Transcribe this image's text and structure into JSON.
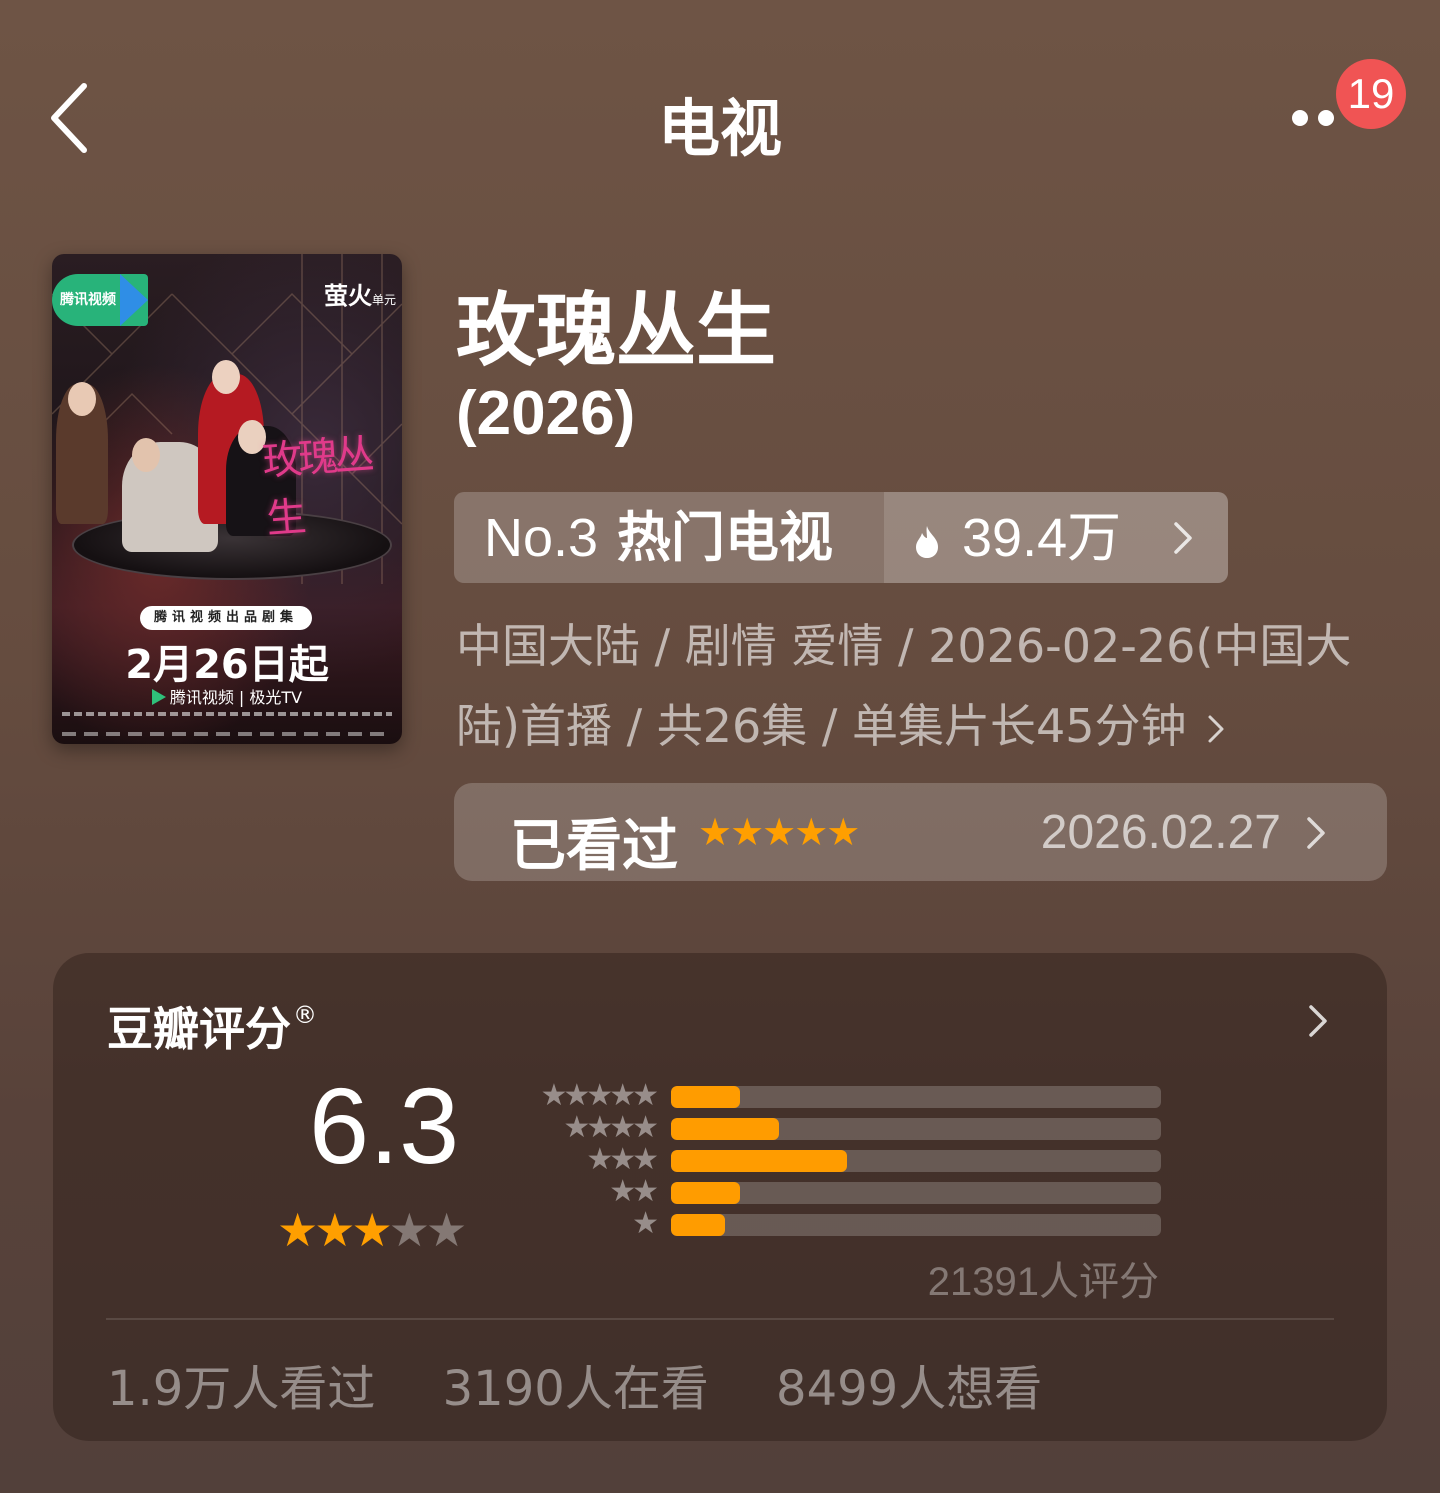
{
  "header": {
    "title": "电视",
    "notification_count": "19"
  },
  "poster": {
    "logo_left": "腾讯视频",
    "logo_right": "萤火",
    "logo_right_small": "单元",
    "calligraphy": "玫瑰丛生",
    "tag": "腾讯视频出品剧集",
    "air_date": "2月26日起",
    "platforms": "腾讯视频 | 极光TV"
  },
  "show": {
    "name": "玫瑰丛生",
    "year": "(2026)",
    "rank": {
      "number": "No.3",
      "label": "热门电视",
      "heat": "39.4万"
    },
    "meta": "中国大陆 / 剧情 爱情 / 2026-02-26(中国大陆)首播 / 共26集 / 单集片长45分钟",
    "watched": {
      "label": "已看过",
      "stars_text": "★★★★★",
      "my_rating": 5,
      "date": "2026.02.27"
    }
  },
  "rating": {
    "title": "豆瓣评分",
    "registered": "®",
    "score": "6.3",
    "score_stars": 3,
    "distribution": [
      {
        "stars": "★★★★★",
        "fraction": 0.14
      },
      {
        "stars": "★★★★",
        "fraction": 0.22
      },
      {
        "stars": "★★★",
        "fraction": 0.36
      },
      {
        "stars": "★★",
        "fraction": 0.14
      },
      {
        "stars": "★",
        "fraction": 0.11
      }
    ],
    "rating_count": "21391人评分",
    "stats": {
      "watched": "1.9万人看过",
      "watching": "3190人在看",
      "want": "8499人想看"
    }
  },
  "colors": {
    "accent_star": "#ff9f00",
    "badge": "#f05454"
  }
}
